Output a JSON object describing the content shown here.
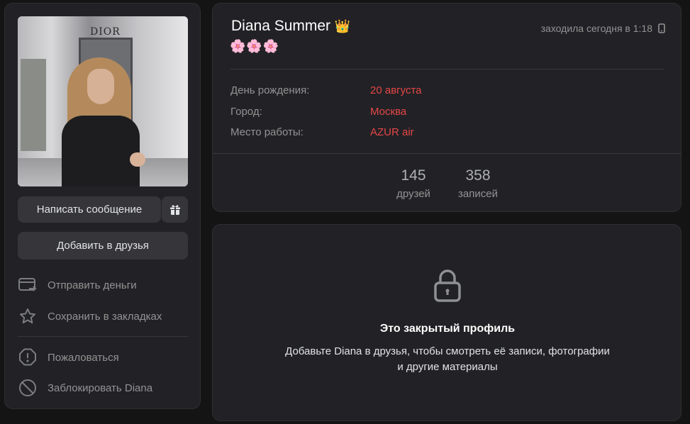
{
  "profile": {
    "name": "Diana Summer",
    "crown": "👑",
    "status_emoji": "🌸🌸🌸",
    "last_seen": "заходила сегодня в 1:18"
  },
  "photo": {
    "sign_text": "DIOR"
  },
  "buttons": {
    "message": "Написать сообщение",
    "add_friend": "Добавить в друзья"
  },
  "actions": {
    "send_money": "Отправить деньги",
    "bookmark": "Сохранить в закладках",
    "report": "Пожаловаться",
    "block": "Заблокировать Diana"
  },
  "info": [
    {
      "label": "День рождения:",
      "value": "20 августа"
    },
    {
      "label": "Город:",
      "value": "Москва"
    },
    {
      "label": "Место работы:",
      "value": "AZUR air"
    }
  ],
  "stats": [
    {
      "count": "145",
      "label": "друзей"
    },
    {
      "count": "358",
      "label": "записей"
    }
  ],
  "private_profile": {
    "title": "Это закрытый профиль",
    "text": "Добавьте Diana в друзья, чтобы смотреть её записи, фотографии и другие материалы"
  },
  "colors": {
    "background": "#141414",
    "card": "#222226",
    "button": "#36363a",
    "accent_red": "#e64646",
    "muted": "#939393"
  }
}
